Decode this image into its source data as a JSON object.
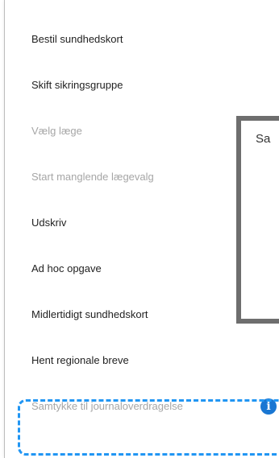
{
  "menu": {
    "items": [
      {
        "label": "Bestil sundhedskort",
        "enabled": true
      },
      {
        "label": "Skift sikringsgruppe",
        "enabled": true
      },
      {
        "label": "Vælg læge",
        "enabled": false
      },
      {
        "label": "Start manglende lægevalg",
        "enabled": false
      },
      {
        "label": "Udskriv",
        "enabled": true
      },
      {
        "label": "Ad hoc opgave",
        "enabled": true
      },
      {
        "label": "Midlertidigt sundhedskort",
        "enabled": true
      },
      {
        "label": "Hent regionale breve",
        "enabled": true
      },
      {
        "label": "Samtykke til journaloverdragelse",
        "enabled": false,
        "icon": "info-icon"
      }
    ]
  },
  "info_icon_glyph": "i",
  "background_dialog": {
    "partial_text": "Sa"
  },
  "colors": {
    "highlight_border": "#2196f3",
    "info_icon": "#1976d2",
    "disabled_text": "#a6a6a6",
    "enabled_text": "#222222",
    "dialog_border": "#6e6e6e"
  }
}
